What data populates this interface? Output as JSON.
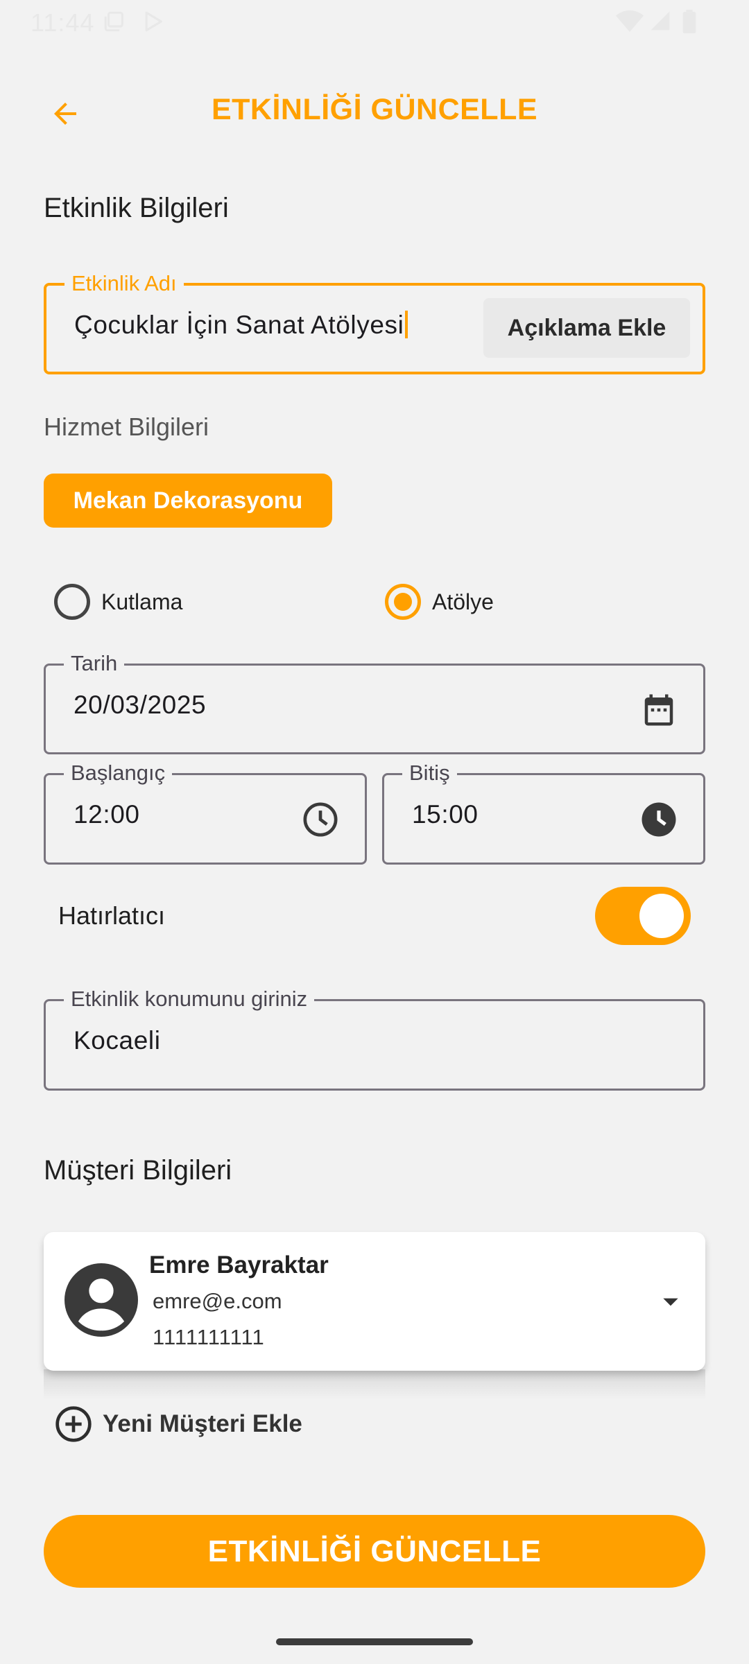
{
  "status_bar": {
    "time": "11:44"
  },
  "app_bar": {
    "title": "ETKİNLİĞİ GÜNCELLE"
  },
  "event_info": {
    "section_title": "Etkinlik Bilgileri",
    "name_label": "Etkinlik Adı",
    "name_value": "Çocuklar İçin Sanat Atölyesi",
    "add_description_label": "Açıklama Ekle"
  },
  "service_info": {
    "section_title": "Hizmet Bilgileri",
    "chip_label": "Mekan Dekorasyonu"
  },
  "event_type": {
    "options": [
      {
        "label": "Kutlama",
        "selected": false
      },
      {
        "label": "Atölye",
        "selected": true
      }
    ]
  },
  "date_field": {
    "label": "Tarih",
    "value": "20/03/2025"
  },
  "start_time": {
    "label": "Başlangıç",
    "value": "12:00"
  },
  "end_time": {
    "label": "Bitiş",
    "value": "15:00"
  },
  "reminder": {
    "label": "Hatırlatıcı",
    "enabled": true
  },
  "location": {
    "label": "Etkinlik konumunu giriniz",
    "value": "Kocaeli"
  },
  "customer_info": {
    "section_title": "Müşteri Bilgileri",
    "name": "Emre Bayraktar",
    "email": "emre@e.com",
    "phone": "1111111111",
    "add_new_label": "Yeni Müşteri Ekle"
  },
  "submit_button": {
    "label": "ETKİNLİĞİ GÜNCELLE"
  },
  "colors": {
    "accent": "#ffa000",
    "background": "#f2f2f2",
    "outline": "#79747e"
  }
}
